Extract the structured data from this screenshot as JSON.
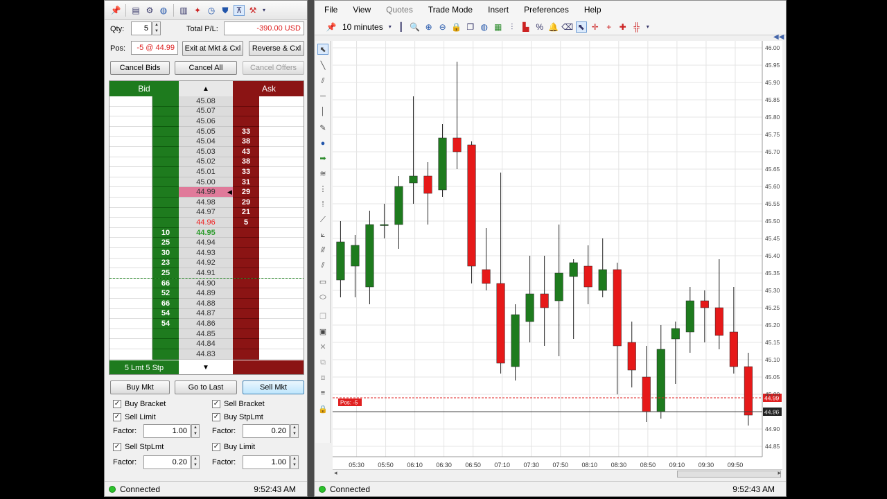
{
  "dom": {
    "qty_label": "Qty:",
    "qty_value": "5",
    "total_pl_label": "Total P/L:",
    "total_pl_value": "-390.00 USD",
    "pos_label": "Pos:",
    "pos_value": "-5 @ 44.99",
    "exit_button": "Exit at Mkt & Cxl",
    "reverse_button": "Reverse & Cxl",
    "cancel_bids": "Cancel Bids",
    "cancel_all": "Cancel All",
    "cancel_offers": "Cancel Offers",
    "bid_header": "Bid",
    "ask_header": "Ask",
    "orders_summary": "5 Lmt 5 Stp",
    "buy_mkt": "Buy Mkt",
    "go_to_last": "Go to Last",
    "sell_mkt": "Sell Mkt",
    "ladder": [
      {
        "price": "45.08",
        "bid": "",
        "ask": ""
      },
      {
        "price": "45.07",
        "bid": "",
        "ask": ""
      },
      {
        "price": "45.06",
        "bid": "",
        "ask": ""
      },
      {
        "price": "45.05",
        "bid": "",
        "ask": "33"
      },
      {
        "price": "45.04",
        "bid": "",
        "ask": "38"
      },
      {
        "price": "45.03",
        "bid": "",
        "ask": "43"
      },
      {
        "price": "45.02",
        "bid": "",
        "ask": "38"
      },
      {
        "price": "45.01",
        "bid": "",
        "ask": "33"
      },
      {
        "price": "45.00",
        "bid": "",
        "ask": "31"
      },
      {
        "price": "44.99",
        "bid": "",
        "ask": "29",
        "position": true
      },
      {
        "price": "44.98",
        "bid": "",
        "ask": "29"
      },
      {
        "price": "44.97",
        "bid": "",
        "ask": "21"
      },
      {
        "price": "44.96",
        "bid": "",
        "ask": "5",
        "best_ask": true
      },
      {
        "price": "44.95",
        "bid": "10",
        "ask": "",
        "best_bid": true
      },
      {
        "price": "44.94",
        "bid": "25",
        "ask": ""
      },
      {
        "price": "44.93",
        "bid": "30",
        "ask": ""
      },
      {
        "price": "44.92",
        "bid": "23",
        "ask": ""
      },
      {
        "price": "44.91",
        "bid": "25",
        "ask": ""
      },
      {
        "price": "44.90",
        "bid": "66",
        "ask": ""
      },
      {
        "price": "44.89",
        "bid": "52",
        "ask": ""
      },
      {
        "price": "44.88",
        "bid": "66",
        "ask": ""
      },
      {
        "price": "44.87",
        "bid": "54",
        "ask": ""
      },
      {
        "price": "44.86",
        "bid": "54",
        "ask": ""
      },
      {
        "price": "44.85",
        "bid": "",
        "ask": ""
      },
      {
        "price": "44.84",
        "bid": "",
        "ask": ""
      },
      {
        "price": "44.83",
        "bid": "",
        "ask": ""
      }
    ],
    "buy_bracket": "Buy Bracket",
    "sell_bracket": "Sell Bracket",
    "sell_limit": "Sell Limit",
    "buy_stp_lmt": "Buy StpLmt",
    "factor_label": "Factor:",
    "factor_1": "1.00",
    "factor_2": "0.20",
    "sell_stp_lmt": "Sell StpLmt",
    "buy_limit": "Buy Limit",
    "factor_3": "0.20",
    "factor_4": "1.00",
    "status": "Connected",
    "time": "9:52:43 AM"
  },
  "chartwin": {
    "menus": [
      "File",
      "View",
      "Quotes",
      "Trade Mode",
      "Insert",
      "Preferences",
      "Help"
    ],
    "period": "10 minutes",
    "status": "Connected",
    "time": "9:52:43 AM",
    "pos_tag": "Pos: -5",
    "price_tag_1": "44.99",
    "price_tag_2": "44.96"
  },
  "colors": {
    "up": "#1e7b1e",
    "down": "#e61919",
    "bid": "#1e7b1e",
    "ask": "#8b1414",
    "position": "#e07a9a"
  },
  "chart_data": {
    "type": "candlestick",
    "ylim": [
      44.82,
      46.02
    ],
    "y_ticks": [
      "46.00",
      "45.95",
      "45.90",
      "45.85",
      "45.80",
      "45.75",
      "45.70",
      "45.65",
      "45.60",
      "45.55",
      "45.50",
      "45.45",
      "45.40",
      "45.35",
      "45.30",
      "45.25",
      "45.20",
      "45.15",
      "45.10",
      "45.05",
      "45.00",
      "44.95",
      "44.90",
      "44.85"
    ],
    "x_ticks": [
      "05:30",
      "05:50",
      "06:10",
      "06:30",
      "06:50",
      "07:10",
      "07:30",
      "07:50",
      "08:10",
      "08:30",
      "08:50",
      "09:10",
      "09:30",
      "09:50"
    ],
    "candles": [
      {
        "o": 45.33,
        "h": 45.5,
        "l": 45.28,
        "c": 45.44
      },
      {
        "o": 45.37,
        "h": 45.46,
        "l": 45.28,
        "c": 45.43
      },
      {
        "o": 45.31,
        "h": 45.53,
        "l": 45.26,
        "c": 45.49
      },
      {
        "o": 45.49,
        "h": 45.55,
        "l": 45.45,
        "c": 45.49
      },
      {
        "o": 45.49,
        "h": 45.63,
        "l": 45.42,
        "c": 45.6
      },
      {
        "o": 45.61,
        "h": 45.86,
        "l": 45.55,
        "c": 45.63
      },
      {
        "o": 45.63,
        "h": 45.67,
        "l": 45.49,
        "c": 45.58
      },
      {
        "o": 45.59,
        "h": 45.78,
        "l": 45.57,
        "c": 45.74
      },
      {
        "o": 45.74,
        "h": 45.96,
        "l": 45.65,
        "c": 45.7
      },
      {
        "o": 45.72,
        "h": 45.73,
        "l": 45.32,
        "c": 45.37
      },
      {
        "o": 45.36,
        "h": 45.48,
        "l": 45.3,
        "c": 45.32
      },
      {
        "o": 45.32,
        "h": 45.64,
        "l": 45.06,
        "c": 45.09
      },
      {
        "o": 45.08,
        "h": 45.26,
        "l": 45.04,
        "c": 45.23
      },
      {
        "o": 45.21,
        "h": 45.4,
        "l": 45.15,
        "c": 45.29
      },
      {
        "o": 45.29,
        "h": 45.4,
        "l": 45.14,
        "c": 45.25
      },
      {
        "o": 45.27,
        "h": 45.49,
        "l": 45.11,
        "c": 45.35
      },
      {
        "o": 45.34,
        "h": 45.39,
        "l": 45.16,
        "c": 45.38
      },
      {
        "o": 45.37,
        "h": 45.43,
        "l": 45.26,
        "c": 45.31
      },
      {
        "o": 45.3,
        "h": 45.45,
        "l": 45.28,
        "c": 45.36
      },
      {
        "o": 45.36,
        "h": 45.38,
        "l": 45.0,
        "c": 45.14
      },
      {
        "o": 45.15,
        "h": 45.21,
        "l": 45.02,
        "c": 45.07
      },
      {
        "o": 45.05,
        "h": 45.14,
        "l": 44.92,
        "c": 44.95
      },
      {
        "o": 44.95,
        "h": 45.2,
        "l": 44.93,
        "c": 45.13
      },
      {
        "o": 45.16,
        "h": 45.21,
        "l": 45.03,
        "c": 45.19
      },
      {
        "o": 45.18,
        "h": 45.31,
        "l": 45.12,
        "c": 45.27
      },
      {
        "o": 45.27,
        "h": 45.3,
        "l": 45.15,
        "c": 45.25
      },
      {
        "o": 45.25,
        "h": 45.39,
        "l": 45.13,
        "c": 45.17
      },
      {
        "o": 45.18,
        "h": 45.31,
        "l": 45.06,
        "c": 45.08
      },
      {
        "o": 45.08,
        "h": 45.12,
        "l": 44.91,
        "c": 44.94
      }
    ],
    "position_price": 44.99,
    "last_price": 44.95
  }
}
